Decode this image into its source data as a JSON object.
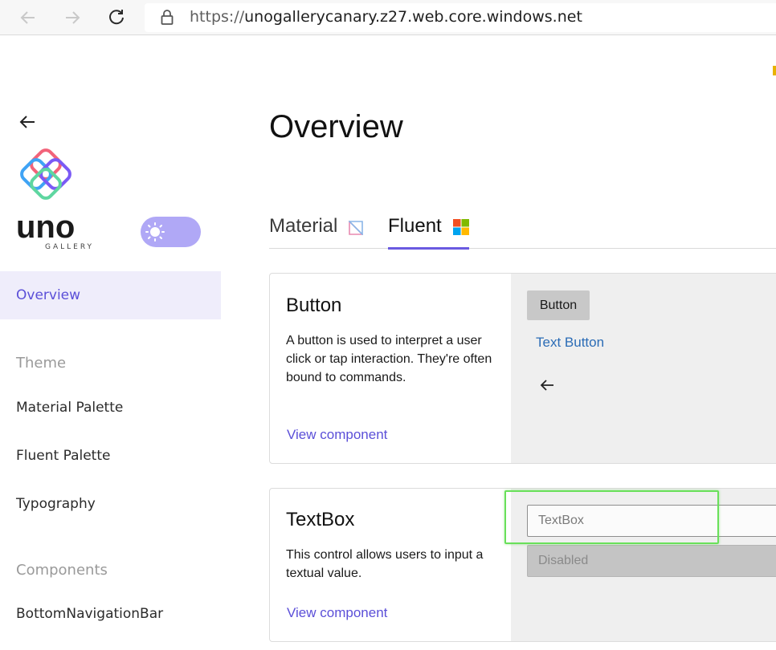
{
  "browser": {
    "url_scheme": "https://",
    "url_host": "unogallerycanary.z27.web.core.windows.net"
  },
  "sidebar": {
    "logo_text": "uno",
    "logo_subtext": "GALLERY",
    "items": [
      {
        "label": "Overview",
        "selected": true
      },
      {
        "label": "Theme",
        "header": true
      },
      {
        "label": "Material Palette"
      },
      {
        "label": "Fluent Palette"
      },
      {
        "label": "Typography"
      },
      {
        "label": "Components",
        "header": true
      },
      {
        "label": "BottomNavigationBar"
      }
    ]
  },
  "main": {
    "title": "Overview",
    "tabs": [
      {
        "label": "Material",
        "icon": "material-icon"
      },
      {
        "label": "Fluent",
        "icon": "windows-logo-icon",
        "selected": true
      }
    ],
    "cards": [
      {
        "title": "Button",
        "description": "A button is used to interpret a user click or tap interaction. They're often bound to commands.",
        "link": "View component",
        "demo_button": "Button",
        "demo_text_button": "Text Button",
        "demo_icon": "arrow-left-icon"
      },
      {
        "title": "TextBox",
        "description": "This control allows users to input a textual value.",
        "link": "View component",
        "placeholder": "TextBox",
        "disabled_placeholder": "Disabled"
      }
    ]
  },
  "colors": {
    "accent": "#5b4fd8",
    "toggle": "#b0a8f6",
    "selected_bg": "#efedfb",
    "highlight": "#69e05a"
  }
}
